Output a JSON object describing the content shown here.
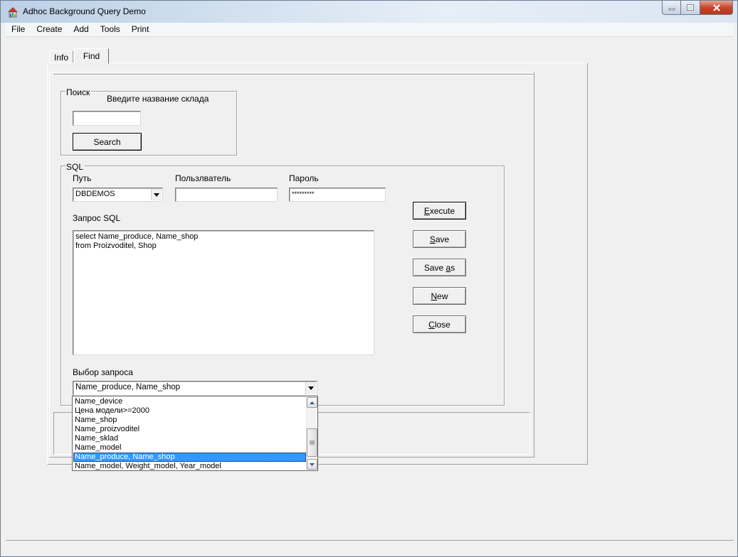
{
  "window": {
    "title": "Adhoc Background Query Demo",
    "icon": "app-icon"
  },
  "menubar": {
    "items": [
      "File",
      "Create",
      "Add",
      "Tools",
      "Print"
    ]
  },
  "tabs": [
    {
      "label": "Info",
      "selected": false
    },
    {
      "label": "Find",
      "selected": true
    }
  ],
  "search_group": {
    "legend": "Поиск",
    "prompt": "Введите название склада",
    "input_value": "",
    "button_label": "Search"
  },
  "sql_group": {
    "legend": "SQL",
    "path_label": "Путь",
    "path_value": "DBDEMOS",
    "user_label": "Пользлватель",
    "user_value": "",
    "password_label": "Пароль",
    "password_value": "*********",
    "query_label": "Запрос SQL",
    "query_text": "select Name_produce, Name_shop\nfrom Proizvoditel, Shop",
    "choice_label": "Выбор запроса",
    "choice_value": "Name_produce, Name_shop",
    "choice_options": [
      "Name_device",
      "Цена модели>=2000",
      "Name_shop",
      "Name_proizvoditel",
      "Name_sklad",
      "Name_model",
      "Name_produce, Name_shop",
      "Name_model,  Weight_model, Year_model"
    ],
    "selected_index": 6
  },
  "buttons": {
    "execute": {
      "pre": "",
      "u": "E",
      "post": "xecute"
    },
    "save": {
      "pre": "",
      "u": "S",
      "post": "ave"
    },
    "save_as": {
      "pre": "Save ",
      "u": "a",
      "post": "s"
    },
    "new": {
      "pre": "",
      "u": "N",
      "post": "ew"
    },
    "close": {
      "pre": "",
      "u": "C",
      "post": "lose"
    }
  },
  "colors": {
    "selection": "#3399ff",
    "close_button": "#c7462b",
    "face": "#f0f0f0"
  }
}
